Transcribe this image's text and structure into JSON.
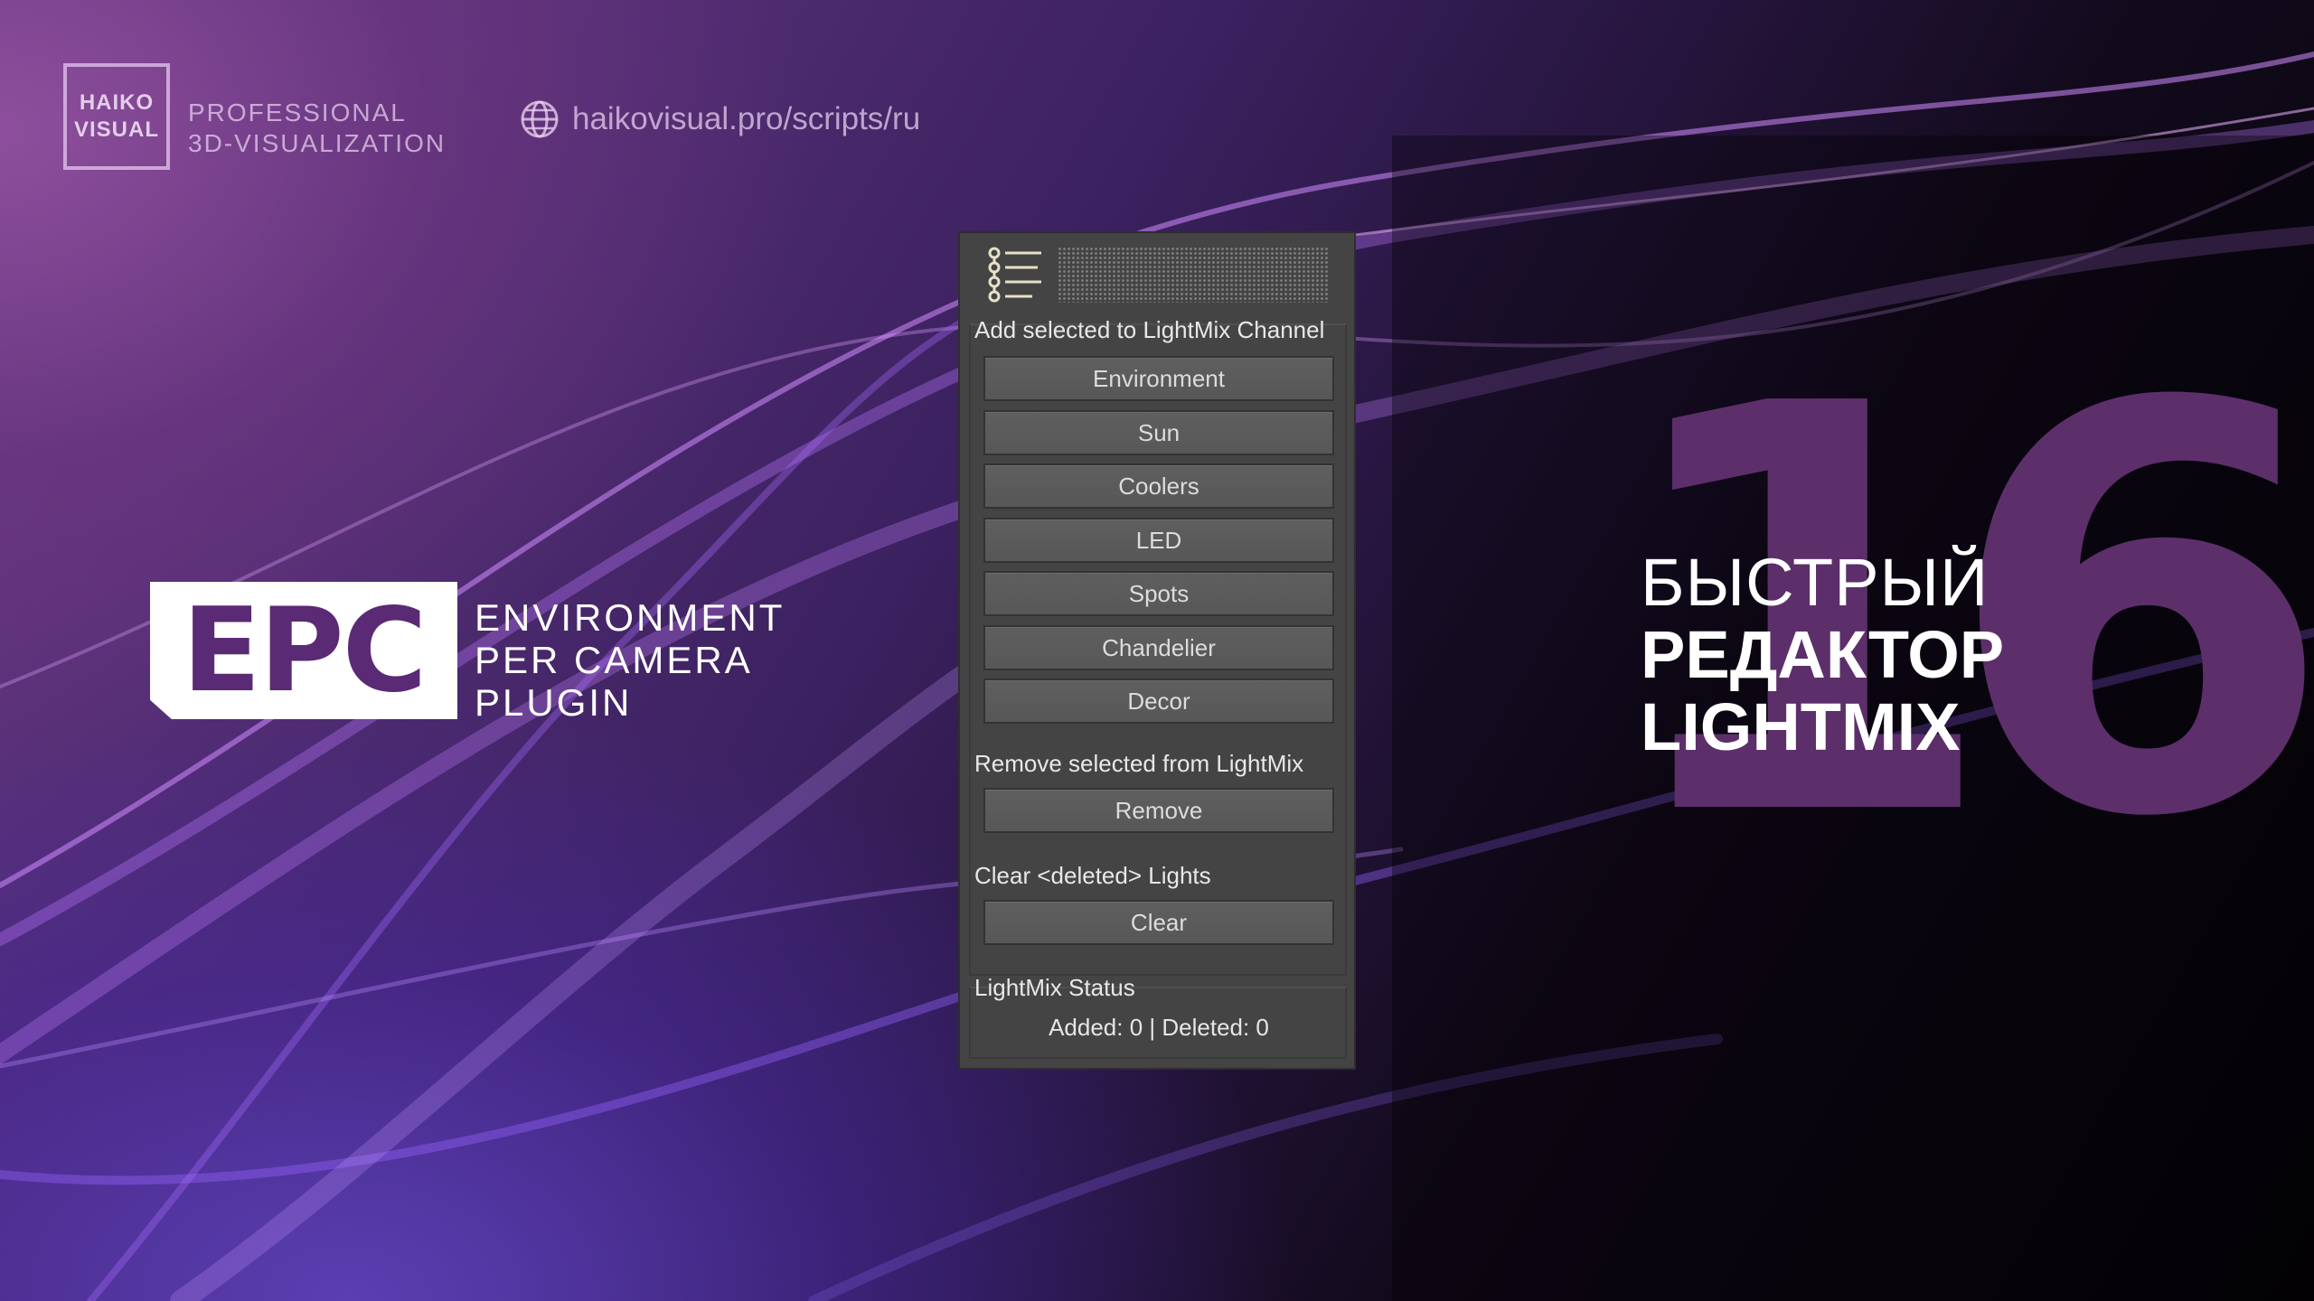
{
  "brand": {
    "logo_line1": "HAIKO",
    "logo_line2": "VISUAL",
    "tag_line1": "PROFESSIONAL",
    "tag_line2": "3D-VISUALIZATION",
    "url": "haikovisual.pro/scripts/ru",
    "globe_icon": "globe-icon"
  },
  "product": {
    "logo_text": "EPC",
    "line1": "ENVIRONMENT",
    "line2": "PER CAMERA",
    "line3": "PLUGIN"
  },
  "headline": {
    "number": "16",
    "line1": "БЫСТРЫЙ",
    "line2": "РЕДАКТОР",
    "line3": "LIGHTMIX"
  },
  "panel": {
    "header_icon": "list-tree-icon",
    "add_group": {
      "title": "Add selected to LightMix Channel",
      "buttons": [
        "Environment",
        "Sun",
        "Coolers",
        "LED",
        "Spots",
        "Chandelier",
        "Decor"
      ]
    },
    "remove_group": {
      "title": "Remove selected from LightMix",
      "button": "Remove"
    },
    "clear_group": {
      "title": "Clear <deleted> Lights",
      "button": "Clear"
    },
    "status_group": {
      "title": "LightMix Status",
      "status": "Added: 0 | Deleted: 0"
    }
  },
  "colors": {
    "panel_bg": "#444444",
    "button_bg": "#5b5b5b",
    "accent_purple": "#5a2a74"
  }
}
